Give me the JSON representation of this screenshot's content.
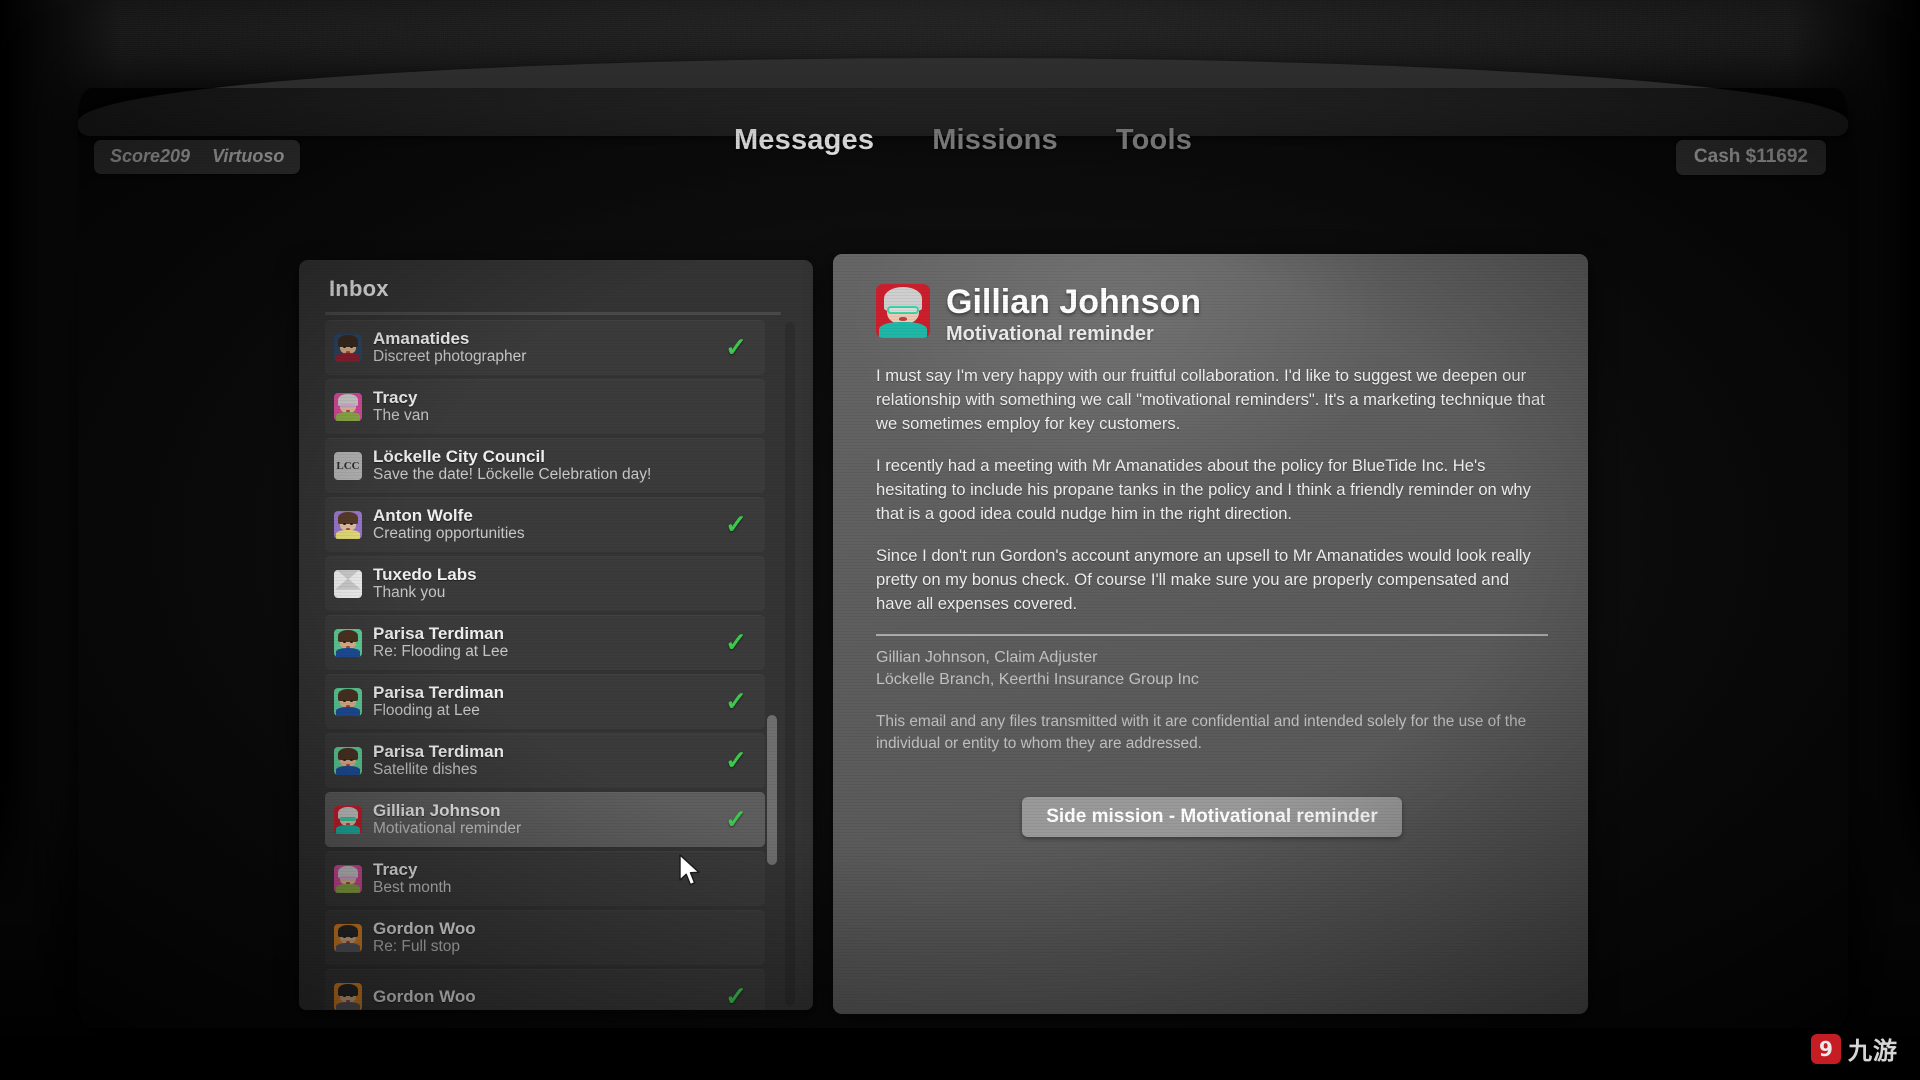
{
  "hud": {
    "score_label": "Score209",
    "rank_label": "Virtuoso",
    "cash_label": "Cash $11692"
  },
  "nav": {
    "tabs": [
      {
        "label": "Messages",
        "active": true
      },
      {
        "label": "Missions",
        "active": false
      },
      {
        "label": "Tools",
        "active": false
      }
    ]
  },
  "inbox": {
    "title": "Inbox",
    "scroll_percent": 62,
    "messages": [
      {
        "name": "Amanatides",
        "subject": "Discreet photographer",
        "read": true,
        "avatar": "avatar-amanatides",
        "avatar_color": "#2c4664",
        "selected": false
      },
      {
        "name": "Tracy",
        "subject": "The van",
        "read": false,
        "avatar": "avatar-tracy",
        "avatar_color": "#d94c9e",
        "selected": false
      },
      {
        "name": "Löckelle City Council",
        "subject": "Save the date! Löckelle Celebration day!",
        "read": false,
        "avatar": "avatar-lcc",
        "avatar_color": "#b4b4b4",
        "avatar_text": "LCC",
        "selected": false
      },
      {
        "name": "Anton Wolfe",
        "subject": "Creating opportunities",
        "read": true,
        "avatar": "avatar-anton-wolfe",
        "avatar_color": "#9b7ad1",
        "selected": false
      },
      {
        "name": "Tuxedo Labs",
        "subject": "Thank you",
        "read": false,
        "avatar": "avatar-tuxedo-labs",
        "avatar_color": "#f2f2f2",
        "selected": false
      },
      {
        "name": "Parisa Terdiman",
        "subject": "Re: Flooding at Lee",
        "read": true,
        "avatar": "avatar-parisa-terdiman",
        "avatar_color": "#5fd19a",
        "selected": false
      },
      {
        "name": "Parisa Terdiman",
        "subject": "Flooding at Lee",
        "read": true,
        "avatar": "avatar-parisa-terdiman",
        "avatar_color": "#5fd19a",
        "selected": false
      },
      {
        "name": "Parisa Terdiman",
        "subject": "Satellite dishes",
        "read": true,
        "avatar": "avatar-parisa-terdiman",
        "avatar_color": "#5fd19a",
        "selected": false
      },
      {
        "name": "Gillian Johnson",
        "subject": "Motivational reminder",
        "read": true,
        "avatar": "avatar-gillian-johnson",
        "avatar_color": "#cc1f2e",
        "selected": true
      },
      {
        "name": "Tracy",
        "subject": "Best month",
        "read": false,
        "avatar": "avatar-tracy",
        "avatar_color": "#d94c9e",
        "selected": false
      },
      {
        "name": "Gordon Woo",
        "subject": "Re: Full stop",
        "read": false,
        "avatar": "avatar-gordon-woo",
        "avatar_color": "#e88c28",
        "selected": false
      },
      {
        "name": "Gordon Woo",
        "subject": "",
        "read": true,
        "avatar": "avatar-gordon-woo",
        "avatar_color": "#e88c28",
        "selected": false
      }
    ],
    "check_glyph": "✓"
  },
  "reading_pane": {
    "sender": "Gillian Johnson",
    "subject": "Motivational reminder",
    "avatar_color": "#cc1f2e",
    "paragraphs": [
      "I must say I'm very happy with our fruitful collaboration. I'd like to suggest we deepen our relationship with something we call \"motivational reminders\". It's a marketing technique that we sometimes employ for key customers.",
      "I recently had a meeting with Mr Amanatides about the policy for BlueTide Inc. He's hesitating to include his propane tanks in the policy and I think a friendly reminder on why that is a good idea could nudge him in the right direction.",
      "Since I don't run Gordon's account anymore an upsell to Mr Amanatides would look really pretty on my bonus check. Of course I'll make sure you are properly compensated and have all expenses covered."
    ],
    "signature_line_1": "Gillian Johnson, Claim Adjuster",
    "signature_line_2": "Löckelle Branch, Keerthi Insurance Group Inc",
    "disclaimer": "This email and any files transmitted with it are confidential and intended solely for the use of the individual or entity to whom they are addressed.",
    "mission_button": "Side mission - Motivational reminder"
  },
  "watermark": {
    "mark": "9",
    "text": "九游"
  }
}
